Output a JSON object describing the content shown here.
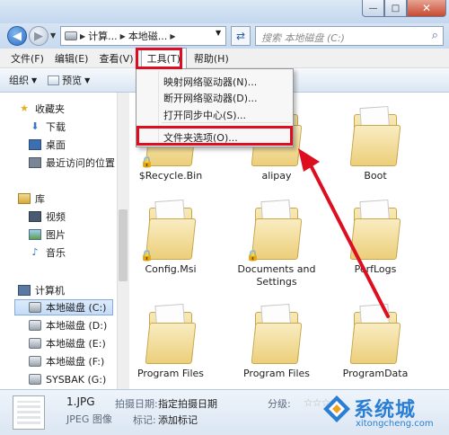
{
  "window": {
    "buttons": {
      "minimize": "—",
      "maximize": "□",
      "close": "✕"
    }
  },
  "address_bar": {
    "breadcrumbs": [
      "计算...",
      "本地磁..."
    ],
    "search_placeholder": "搜索 本地磁盘 (C:)"
  },
  "menubar": {
    "items": [
      "文件(F)",
      "编辑(E)",
      "查看(V)",
      "工具(T)",
      "帮助(H)"
    ]
  },
  "toolbar": {
    "organize": "组织",
    "preview": "预览"
  },
  "tools_menu": {
    "items": [
      "映射网络驱动器(N)...",
      "断开网络驱动器(D)...",
      "打开同步中心(S)...",
      "文件夹选项(O)..."
    ]
  },
  "sidebar": {
    "favorites": {
      "label": "收藏夹",
      "items": [
        "下载",
        "桌面",
        "最近访问的位置"
      ]
    },
    "libraries": {
      "label": "库",
      "items": [
        "视频",
        "图片",
        "音乐"
      ]
    },
    "computer": {
      "label": "计算机",
      "items": [
        "本地磁盘 (C:)",
        "本地磁盘 (D:)",
        "本地磁盘 (E:)",
        "本地磁盘 (F:)",
        "SYSBAK (G:)"
      ]
    }
  },
  "files": [
    "$Recycle.Bin",
    "alipay",
    "Boot",
    "Config.Msi",
    "Documents and Settings",
    "PerfLogs",
    "Program Files",
    "Program Files",
    "ProgramData"
  ],
  "details": {
    "filename": "1.JPG",
    "filetype": "JPEG 图像",
    "date_label": "拍摄日期:",
    "date_value": "指定拍摄日期",
    "tags_label": "标记:",
    "tags_value": "添加标记",
    "rating_label": "分级:"
  },
  "watermark": {
    "brand": "系统城",
    "url": "xitongcheng.com"
  },
  "colors": {
    "highlight": "#dd0e20",
    "accent": "#2a7fd4"
  }
}
